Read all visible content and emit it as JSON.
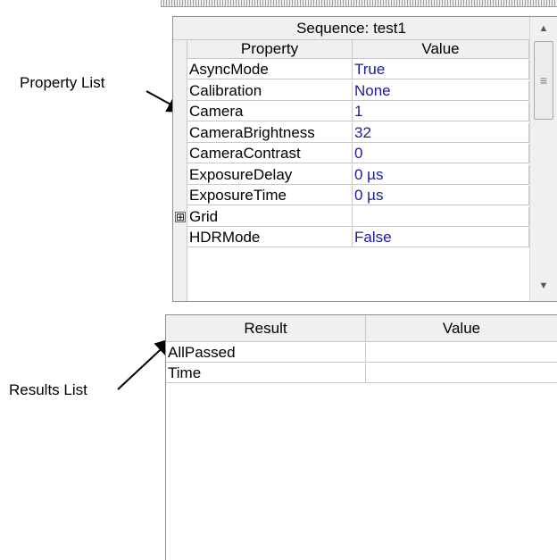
{
  "callouts": {
    "property_list": "Property List",
    "results_list": "Results List"
  },
  "property_grid": {
    "title": "Sequence: test1",
    "headers": {
      "property": "Property",
      "value": "Value"
    },
    "rows": [
      {
        "property": "AsyncMode",
        "value": "True"
      },
      {
        "property": "Calibration",
        "value": "None"
      },
      {
        "property": "Camera",
        "value": "1"
      },
      {
        "property": "CameraBrightness",
        "value": "32"
      },
      {
        "property": "CameraContrast",
        "value": "0"
      },
      {
        "property": "ExposureDelay",
        "value": "0 µs"
      },
      {
        "property": "ExposureTime",
        "value": "0 µs"
      },
      {
        "property": "Grid",
        "value": "",
        "expander": "⊞"
      },
      {
        "property": "HDRMode",
        "value": "False"
      }
    ],
    "scrollbar": {
      "up_icon": "▲",
      "down_icon": "▼",
      "thumb_icon": "≡"
    }
  },
  "results_grid": {
    "headers": {
      "result": "Result",
      "value": "Value"
    },
    "rows": [
      {
        "result": "AllPassed",
        "value": ""
      },
      {
        "result": "Time",
        "value": ""
      }
    ]
  },
  "colors": {
    "value_text": "#1b1b9c",
    "header_bg": "#f0f0f0",
    "grid_line": "#c8c8c8"
  }
}
